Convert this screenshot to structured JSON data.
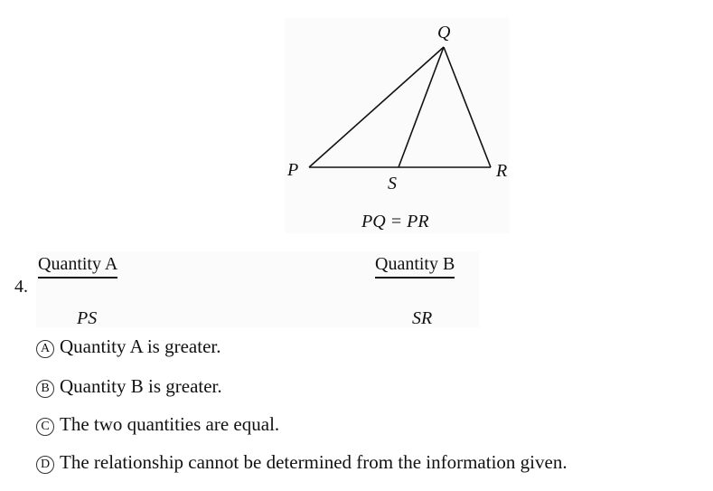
{
  "figure": {
    "points": {
      "P": "P",
      "Q": "Q",
      "R": "R",
      "S": "S"
    },
    "given": "PQ = PR"
  },
  "question": {
    "number": "4.",
    "quantity_a": {
      "header": "Quantity A",
      "value": "PS"
    },
    "quantity_b": {
      "header": "Quantity B",
      "value": "SR"
    }
  },
  "choices": [
    {
      "letter": "A",
      "text": "Quantity A is greater."
    },
    {
      "letter": "B",
      "text": "Quantity B is greater."
    },
    {
      "letter": "C",
      "text": "The two quantities are equal."
    },
    {
      "letter": "D",
      "text": "The relationship cannot be determined from the information given."
    }
  ]
}
